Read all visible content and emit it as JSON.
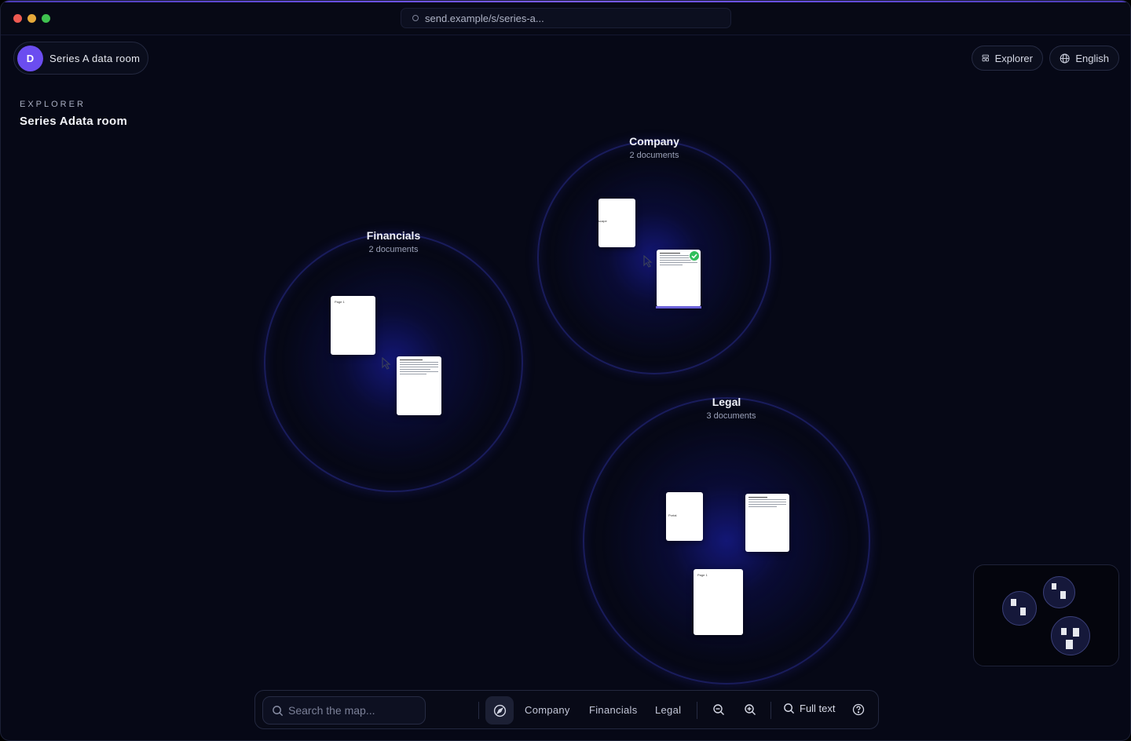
{
  "browser": {
    "url": "send.example/s/series-a..."
  },
  "room": {
    "avatar_letter": "D",
    "name": "Series A data room"
  },
  "header": {
    "explorer_label": "Explorer",
    "language_label": "English"
  },
  "sidebar": {
    "section_label": "EXPLORER",
    "title": "Series Adata room"
  },
  "clusters": [
    {
      "name": "Financials",
      "count": "2 documents",
      "docs": [
        {
          "tag": "Page 1"
        },
        {
          "tag": ""
        }
      ]
    },
    {
      "name": "Company",
      "count": "2 documents",
      "docs": [
        {
          "tag": "scape"
        },
        {
          "tag": ""
        }
      ]
    },
    {
      "name": "Legal",
      "count": "3 documents",
      "docs": [
        {
          "tag": "Portal"
        },
        {
          "tag": ""
        },
        {
          "tag": "Page 1"
        }
      ]
    }
  ],
  "toolbar": {
    "search_placeholder": "Search the map...",
    "links": [
      "Company",
      "Financials",
      "Legal"
    ],
    "full_text_label": "Full text"
  },
  "colors": {
    "background": "#060816",
    "accent": "#6b4df0",
    "cluster_ring": "#2a2e96",
    "check": "#2fbf5a"
  },
  "icons": {
    "explorer": "layout-icon",
    "language": "globe-icon",
    "search": "search-icon",
    "compass": "compass-icon",
    "zoom_out": "zoom-out-icon",
    "zoom_in": "zoom-in-icon",
    "help": "help-circle-icon"
  }
}
